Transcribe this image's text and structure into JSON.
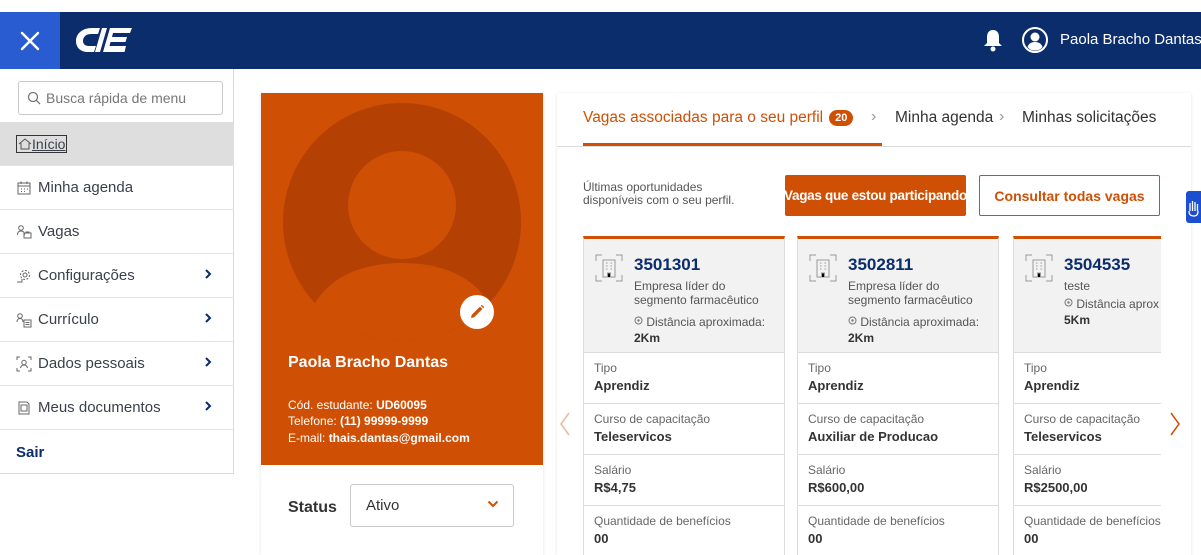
{
  "header": {
    "user_name": "Paola Bracho Dantas",
    "accent": "#0c2d6b"
  },
  "sidebar": {
    "search_placeholder": "Busca rápida de menu",
    "items": [
      {
        "label": "Início",
        "icon": "home-icon",
        "active": true
      },
      {
        "label": "Minha agenda",
        "icon": "calendar-icon"
      },
      {
        "label": "Vagas",
        "icon": "people-icon"
      },
      {
        "label": "Configurações",
        "icon": "gear-icon",
        "expandable": true
      },
      {
        "label": "Currículo",
        "icon": "resume-icon",
        "expandable": true
      },
      {
        "label": "Dados pessoais",
        "icon": "id-icon",
        "expandable": true
      },
      {
        "label": "Meus documentos",
        "icon": "document-icon",
        "expandable": true
      },
      {
        "label": "Sair"
      }
    ]
  },
  "profile": {
    "name": "Paola Bracho Dantas",
    "code_label": "Cód. estudante:",
    "code": "UD60095",
    "phone_label": "Telefone:",
    "phone": "(11) 99999-9999",
    "email_label": "E-mail:",
    "email": "thais.dantas@gmail.com",
    "status_label": "Status",
    "status_value": "Ativo",
    "color": "#cf4f05"
  },
  "tabs": {
    "vagas": "Vagas associadas para o seu perfil",
    "vagas_count": "20",
    "agenda": "Minha agenda",
    "solicitacoes": "Minhas solicitações"
  },
  "panel": {
    "intro": "Últimas oportunidades disponíveis com o seu perfil.",
    "btn_participating": "Vagas que estou participando",
    "btn_all": "Consultar todas vagas"
  },
  "labels": {
    "tipo": "Tipo",
    "curso": "Curso de capacitação",
    "salario": "Salário",
    "beneficios": "Quantidade de benefícios",
    "distancia": "Distância aproximada:"
  },
  "jobs": [
    {
      "code": "3501301",
      "company": "Empresa líder do segmento farmacêutico",
      "distance_label": "Distância aproximada:",
      "distance": "2Km",
      "tipo": "Aprendiz",
      "curso": "Teleservicos",
      "salario": "R$4,75",
      "beneficios": "00"
    },
    {
      "code": "3502811",
      "company": "Empresa líder do segmento farmacêutico",
      "distance_label": "Distância aproximada:",
      "distance": "2Km",
      "tipo": "Aprendiz",
      "curso": "Auxiliar de Producao",
      "salario": "R$600,00",
      "beneficios": "00"
    },
    {
      "code": "3504535",
      "company": "teste",
      "distance_label": "Distância aprox",
      "distance": "5Km",
      "tipo": "Aprendiz",
      "curso": "Teleservicos",
      "salario": "R$2500,00",
      "beneficios": "00"
    }
  ]
}
